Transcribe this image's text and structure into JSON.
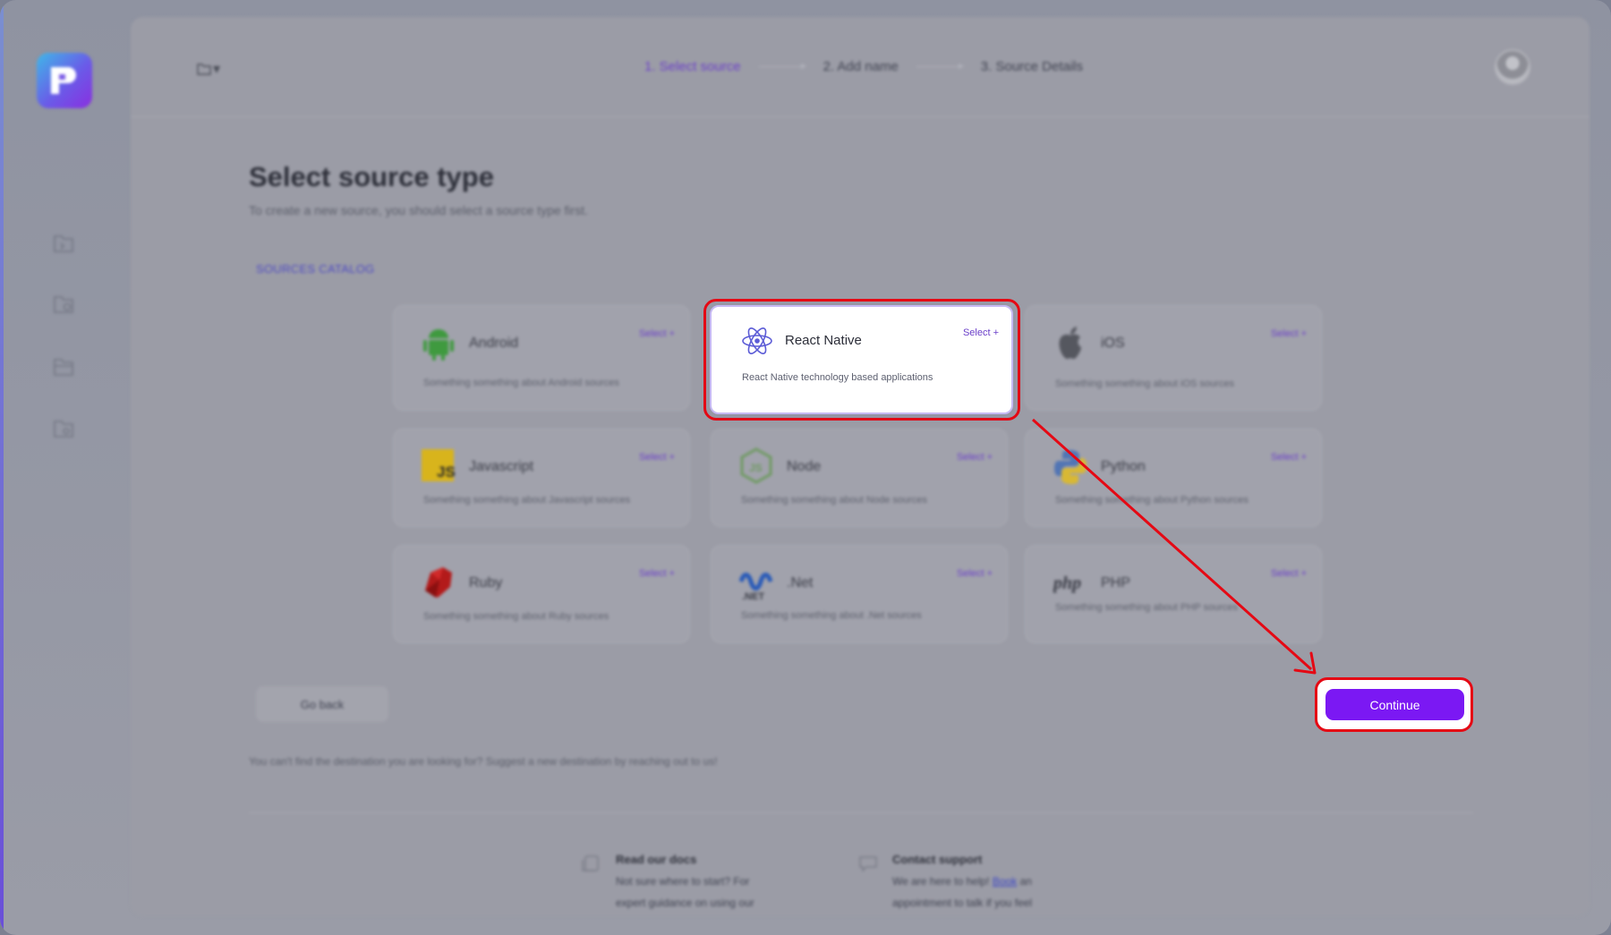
{
  "app": {
    "folder_menu_label": "▾"
  },
  "steps": [
    {
      "label": "1. Select source",
      "active": true
    },
    {
      "label": "2. Add name",
      "active": false
    },
    {
      "label": "3. Source Details",
      "active": false
    }
  ],
  "page": {
    "title": "Select source type",
    "subtitle": "To create a new source, you should select a source type first.",
    "catalog_label": "SOURCES CATALOG"
  },
  "sources": [
    {
      "name": "Android",
      "select": "Select +",
      "desc": "Something something about Android sources",
      "icon": "android-icon"
    },
    {
      "name": "React Native",
      "select": "Select +",
      "desc": "React Native technology based applications",
      "icon": "react-icon",
      "selected": true
    },
    {
      "name": "iOS",
      "select": "Select +",
      "desc": "Something something about iOS sources",
      "icon": "apple-icon"
    },
    {
      "name": "Javascript",
      "select": "Select +",
      "desc": "Something something about Javascript sources",
      "icon": "js-icon"
    },
    {
      "name": "Node",
      "select": "Select +",
      "desc": "Something something about Node sources",
      "icon": "node-icon"
    },
    {
      "name": "Python",
      "select": "Select +",
      "desc": "Something something about Python sources",
      "icon": "python-icon"
    },
    {
      "name": "Ruby",
      "select": "Select +",
      "desc": "Something something about Ruby sources",
      "icon": "ruby-icon"
    },
    {
      "name": ".Net",
      "select": "Select +",
      "desc": "Something something about .Net sources",
      "icon": "dotnet-icon"
    },
    {
      "name": "PHP",
      "select": "Select +",
      "desc": "Something something about PHP sources",
      "icon": "php-icon"
    }
  ],
  "actions": {
    "go_back": "Go back",
    "continue": "Continue"
  },
  "cant_find": "You can't find the destination you are looking for? Suggest a new destination by reaching out to us!",
  "help": {
    "docs_title": "Read our docs",
    "docs_line1": "Not sure where to start? For",
    "docs_line2": "expert guidance on using our",
    "support_title": "Contact support",
    "support_line1_pre": "We are here to help!",
    "support_link": "Book",
    "support_line1_post": "an",
    "support_line2": "appointment to talk if you feel"
  },
  "colors": {
    "accent": "#7b18f3",
    "highlight": "#e50914",
    "step_active": "#6b3fc9"
  }
}
